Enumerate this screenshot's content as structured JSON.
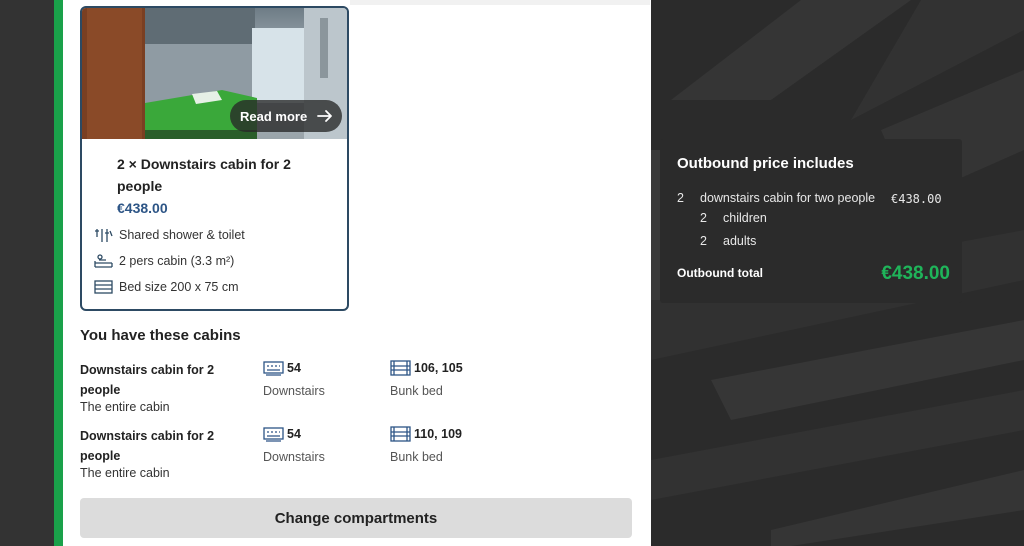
{
  "card": {
    "read_more_label": "Read more",
    "title": "2 × Downstairs cabin for 2 people",
    "price": "€438.00",
    "features": [
      {
        "icon": "shower-icon",
        "label": "Shared shower & toilet"
      },
      {
        "icon": "person-bed-icon",
        "label": "2 pers cabin (3.3 m²)"
      },
      {
        "icon": "bed-icon",
        "label": "Bed size 200 x 75 cm"
      }
    ]
  },
  "cabins": {
    "title": "You have these cabins",
    "rows": [
      {
        "name": "Downstairs cabin for 2 people",
        "sub": "The entire cabin",
        "deck_number": "54",
        "deck_label": "Downstairs",
        "beds": "106, 105",
        "bed_label": "Bunk bed"
      },
      {
        "name": "Downstairs cabin for 2 people",
        "sub": "The entire cabin",
        "deck_number": "54",
        "deck_label": "Downstairs",
        "beds": "110, 109",
        "bed_label": "Bunk bed"
      }
    ]
  },
  "change_button_label": "Change compartments",
  "summary": {
    "title": "Outbound price includes",
    "items": [
      {
        "qty": "2",
        "label": "downstairs cabin for two people",
        "price": "€438.00"
      },
      {
        "qty": "2",
        "label": "children"
      },
      {
        "qty": "2",
        "label": "adults"
      }
    ],
    "total_label": "Outbound total",
    "total_value": "€438.00"
  },
  "colors": {
    "accent_green": "#1aa14a",
    "price_blue": "#2d5586",
    "total_green": "#1fb55a",
    "card_border": "#2d4a63"
  }
}
